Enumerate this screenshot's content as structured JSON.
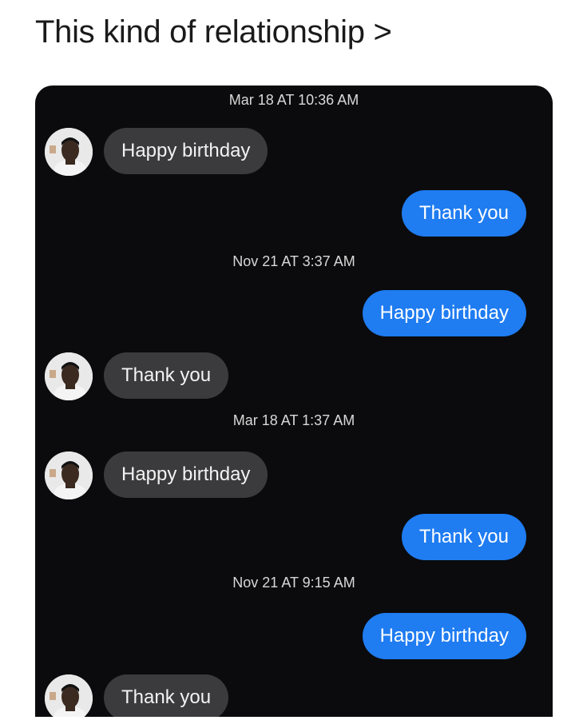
{
  "caption": "This kind of relationship >",
  "colors": {
    "chat_background": "#0b0b0d",
    "incoming_bubble": "#3b3b3d",
    "outgoing_bubble": "#1f7cf1",
    "timestamp_text": "#d8d8d8"
  },
  "chat": {
    "items": [
      {
        "type": "timestamp",
        "text": "Mar 18 AT 10:36 AM"
      },
      {
        "type": "message",
        "direction": "incoming",
        "text": "Happy birthday",
        "avatar": "contact-avatar"
      },
      {
        "type": "message",
        "direction": "outgoing",
        "text": "Thank you"
      },
      {
        "type": "timestamp",
        "text": "Nov 21 AT 3:37 AM"
      },
      {
        "type": "message",
        "direction": "outgoing",
        "text": "Happy birthday"
      },
      {
        "type": "message",
        "direction": "incoming",
        "text": "Thank you",
        "avatar": "contact-avatar"
      },
      {
        "type": "timestamp",
        "text": "Mar 18 AT 1:37 AM"
      },
      {
        "type": "message",
        "direction": "incoming",
        "text": "Happy birthday",
        "avatar": "contact-avatar"
      },
      {
        "type": "message",
        "direction": "outgoing",
        "text": "Thank you"
      },
      {
        "type": "timestamp",
        "text": "Nov 21 AT 9:15 AM"
      },
      {
        "type": "message",
        "direction": "outgoing",
        "text": "Happy birthday"
      },
      {
        "type": "message",
        "direction": "incoming",
        "text": "Thank you",
        "avatar": "contact-avatar"
      }
    ]
  }
}
